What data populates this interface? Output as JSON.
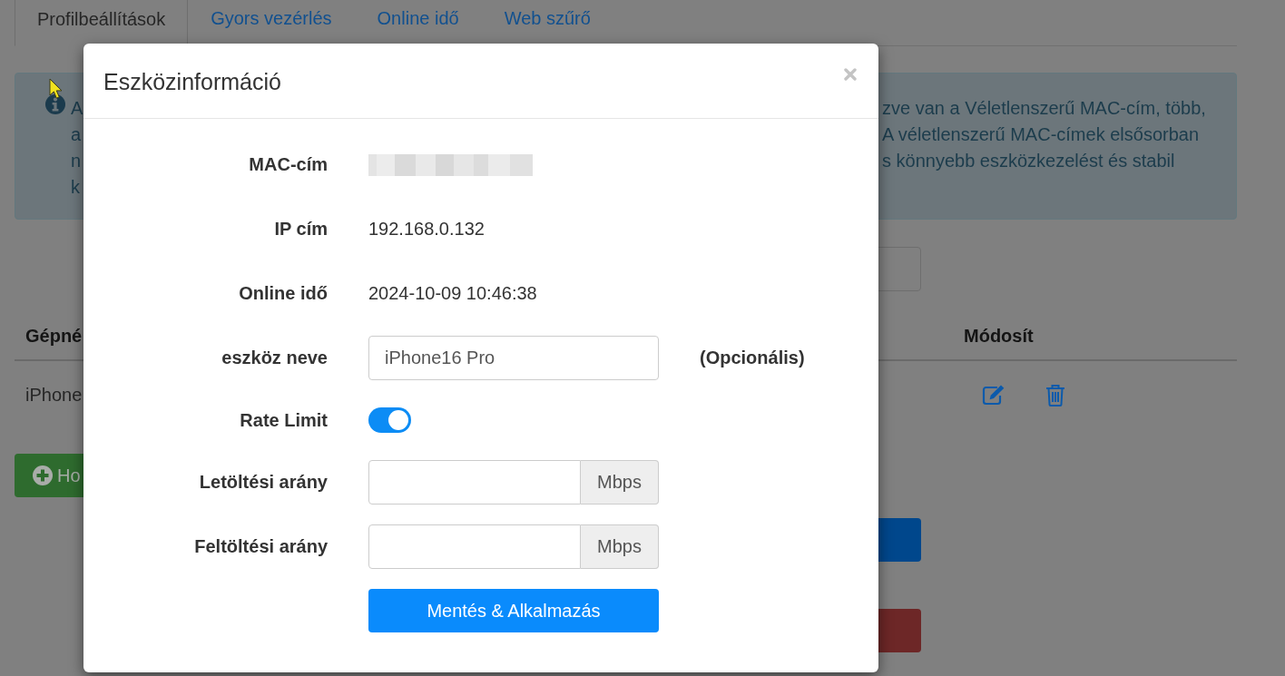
{
  "tabs": [
    {
      "label": "Profilbeállítások",
      "selected": true
    },
    {
      "label": "Gyors vezérlés",
      "selected": false
    },
    {
      "label": "Online idő",
      "selected": false
    },
    {
      "label": "Web szűrő",
      "selected": false
    }
  ],
  "alert": {
    "lines": [
      {
        "start": "A",
        "end": "zve van a Véletlenszerű MAC-cím, több,"
      },
      {
        "start": "a",
        "end": "A véletlenszerű MAC-címek elsősorban"
      },
      {
        "start": "n",
        "end": "s könnyebb eszközkezelést és stabil"
      },
      {
        "start": "k"
      }
    ]
  },
  "table": {
    "columns": [
      "Gépné",
      "Módosít"
    ],
    "rows": [
      {
        "cells": [
          "iPhone"
        ]
      }
    ]
  },
  "add_button": {
    "label": "Ho"
  },
  "modal": {
    "title": "Eszközinformáció",
    "fields": [
      {
        "kind": "redacted",
        "label": "MAC-cím"
      },
      {
        "kind": "text",
        "label": "IP cím",
        "value": "192.168.0.132"
      },
      {
        "kind": "text",
        "label": "Online idő",
        "value": "2024-10-09 10:46:38"
      },
      {
        "kind": "input",
        "label": "eszköz neve",
        "value": "iPhone16 Pro",
        "note": "(Opcionális)"
      },
      {
        "kind": "toggle",
        "label": "Rate Limit",
        "on": true
      },
      {
        "kind": "unit_input",
        "label": "Letöltési arány",
        "unit": "Mbps"
      },
      {
        "kind": "unit_input",
        "label": "Feltöltési arány",
        "unit": "Mbps"
      }
    ],
    "save_button": "Mentés & Alkalmazás"
  }
}
